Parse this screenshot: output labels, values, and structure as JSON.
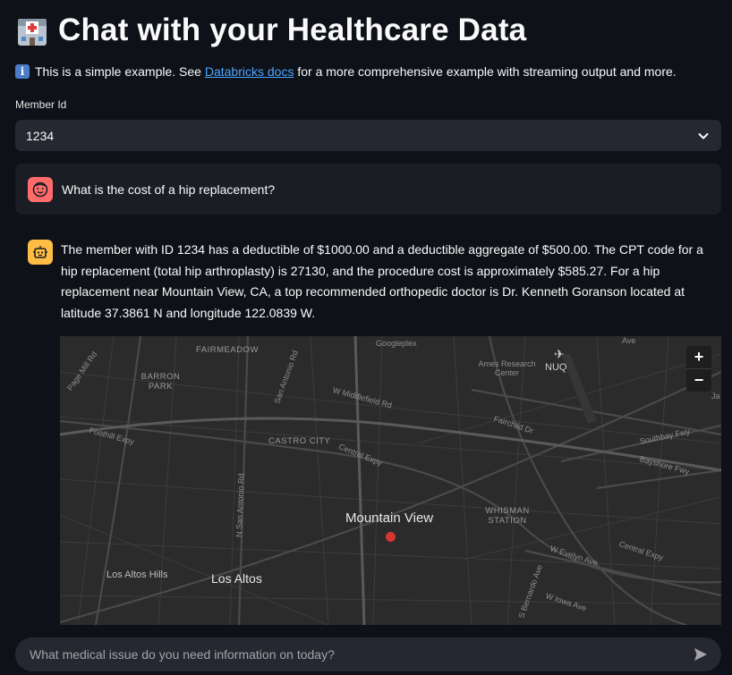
{
  "header": {
    "title": "Chat with your Healthcare Data",
    "icon": "hospital-icon"
  },
  "info": {
    "icon": "info-icon",
    "before": "This is a simple example. See ",
    "link_text": "Databricks docs",
    "after": " for a more comprehensive example with streaming output and more."
  },
  "member_select": {
    "label": "Member Id",
    "value": "1234"
  },
  "messages": [
    {
      "role": "user",
      "avatar_icon": "user-face-icon",
      "text": "What is the cost of a hip replacement?"
    },
    {
      "role": "assistant",
      "avatar_icon": "robot-icon",
      "text": "The member with ID 1234 has a deductible of $1000.00 and a deductible aggregate of $500.00. The CPT code for a hip replacement (total hip arthroplasty) is 27130, and the procedure cost is approximately $585.27. For a hip replacement near Mountain View, CA, a top recommended orthopedic doctor is Dr. Kenneth Goranson located at latitude 37.3861 N and longitude 122.0839 W."
    }
  ],
  "map": {
    "labels": {
      "fairmeadow": "FAIRMEADOW",
      "barron_park": "BARRON PARK",
      "castro_city": "CASTRO CITY",
      "whisman": "WHISMAN STATION",
      "googleplex": "Googleplex",
      "ames": "Ames Research Center",
      "nuq": "NUQ",
      "mountain_view": "Mountain View",
      "los_altos": "Los Altos",
      "los_altos_hills": "Los Altos Hills"
    },
    "streets": {
      "page_mill": "Page Mill Rd",
      "san_antonio_top": "San Antonio Rd",
      "middlefield": "W Middlefield Rd",
      "fairchild": "Fairchild Dr",
      "foothill": "Foothill Expy",
      "central": "Central Expy",
      "central2": "Central Expy",
      "n_san_antonio": "N San Antonio Rd",
      "southbay": "Southbay Fwy",
      "bayshore": "Bayshore Fwy",
      "evelyn": "W Evelyn Ave",
      "iowa": "W Iowa Ave",
      "s_bernardo": "S Bernardo Ave",
      "ave_top": "Ave",
      "ja": "Ja"
    },
    "zoom_in": "+",
    "zoom_out": "−",
    "marker": {
      "lat": 37.3861,
      "lon": -122.0839,
      "color": "#d6372e"
    }
  },
  "chat_input": {
    "placeholder": "What medical issue do you need information on today?",
    "send_icon": "send-icon"
  },
  "colors": {
    "background": "#0e1117",
    "panel": "#262730",
    "link": "#4da6ff",
    "user_avatar": "#ff6b6b",
    "bot_avatar": "#ffbd45"
  }
}
